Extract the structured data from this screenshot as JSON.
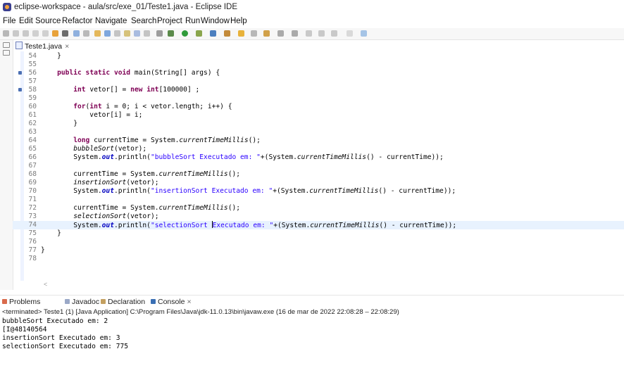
{
  "window": {
    "title": "eclipse-workspace - aula/src/exe_01/Teste1.java - Eclipse IDE"
  },
  "menu": [
    "File",
    "Edit",
    "Source",
    "Refactor",
    "Navigate",
    "Search",
    "Project",
    "Run",
    "Window",
    "Help"
  ],
  "editor": {
    "tab_label": "Teste1.java",
    "tab_close": "×",
    "line_numbers": [
      "54",
      "55",
      "56",
      "57",
      "58",
      "59",
      "60",
      "61",
      "62",
      "63",
      "64",
      "65",
      "66",
      "67",
      "68",
      "69",
      "70",
      "71",
      "72",
      "73",
      "74",
      "75",
      "76",
      "77",
      "78"
    ],
    "lines": [
      "    }",
      "",
      "    public static void main(String[] args) {",
      "",
      "        int vetor[] = new int[100000] ;",
      "",
      "        for(int i = 0; i < vetor.length; i++) {",
      "            vetor[i] = i;",
      "        }",
      "",
      "        long currentTime = System.currentTimeMillis();",
      "        bubbleSort(vetor);",
      "        System.out.println(\"bubbleSort Executado em: \"+(System.currentTimeMillis() - currentTime));",
      "",
      "        currentTime = System.currentTimeMillis();",
      "        insertionSort(vetor);",
      "        System.out.println(\"insertionSort Executado em: \"+(System.currentTimeMillis() - currentTime));",
      "",
      "        currentTime = System.currentTimeMillis();",
      "        selectionSort(vetor);",
      "        System.out.println(\"selectionSort Executado em: \"+(System.currentTimeMillis() - currentTime));",
      "    }",
      "",
      "}",
      ""
    ],
    "current_line": "74"
  },
  "panel": {
    "tabs": [
      "Problems",
      "Javadoc",
      "Declaration",
      "Console"
    ],
    "console_close": "×",
    "status": "<terminated> Teste1 (1) [Java Application] C:\\Program Files\\Java\\jdk-11.0.13\\bin\\javaw.exe  (16 de mar de 2022 22:08:28 – 22:08:29)",
    "console_output": [
      "bubbleSort Executado em: 2",
      "[I@48140564",
      "insertionSort Executado em: 3",
      "selectionSort Executado em: 775"
    ]
  },
  "colors": {
    "keyword": "#7f0055",
    "string": "#2a00ff",
    "field": "#0000c0",
    "current_line": "#e8f2fe"
  }
}
